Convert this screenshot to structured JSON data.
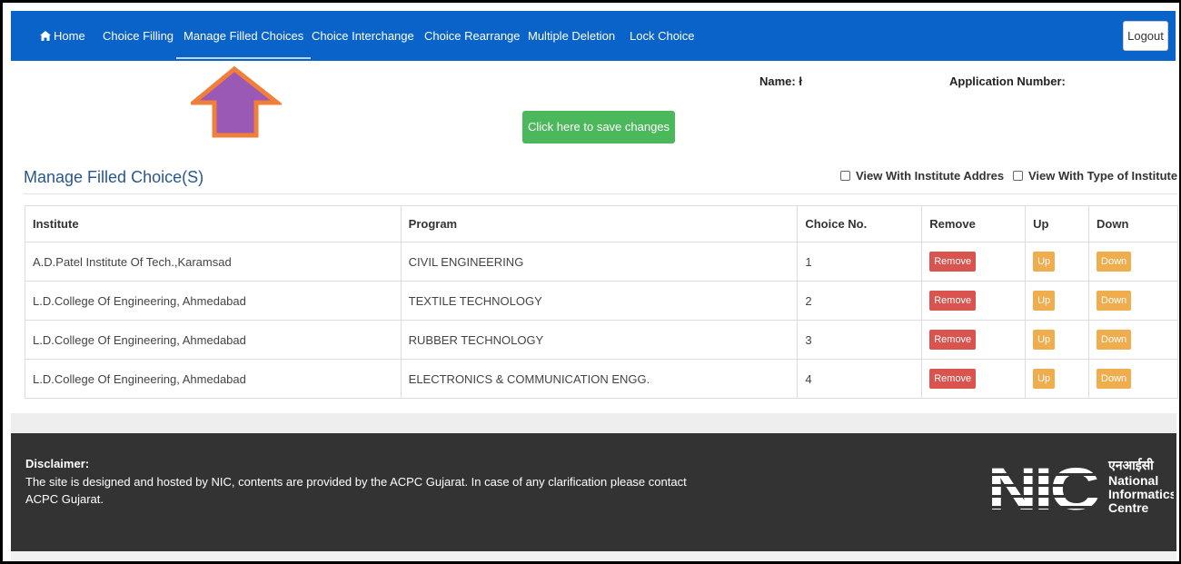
{
  "nav": {
    "items": [
      {
        "label": "Home",
        "icon": "home-icon"
      },
      {
        "label": "Choice Filling"
      },
      {
        "label": "Manage Filled Choices",
        "active": true
      },
      {
        "label": "Choice Interchange"
      },
      {
        "label": "Choice Rearrange"
      },
      {
        "label": "Multiple Deletion"
      },
      {
        "label": "Lock Choice"
      }
    ],
    "logout_label": "Logout"
  },
  "applicant": {
    "name_label": "Name: ł",
    "application_number_label": "Application Number:"
  },
  "save_button_label": "Click here to save changes",
  "section": {
    "title": "Manage Filled Choice(S)",
    "view_with_address_label": "View With Institute Addres",
    "view_with_type_label": "View With Type of Institutе"
  },
  "table": {
    "headers": [
      "Institute",
      "Program",
      "Choice No.",
      "Remove",
      "Up",
      "Down"
    ],
    "rows": [
      {
        "institute": "A.D.Patel Institute Of Tech.,Karamsad",
        "program": "CIVIL ENGINEERING",
        "choice_no": "1",
        "remove": "Remove",
        "up": "Up",
        "down": "Down"
      },
      {
        "institute": "L.D.College Of Engineering, Ahmedabad",
        "program": "TEXTILE TECHNOLOGY",
        "choice_no": "2",
        "remove": "Remove",
        "up": "Up",
        "down": "Down"
      },
      {
        "institute": "L.D.College Of Engineering, Ahmedabad",
        "program": "RUBBER TECHNOLOGY",
        "choice_no": "3",
        "remove": "Remove",
        "up": "Up",
        "down": "Down"
      },
      {
        "institute": "L.D.College Of Engineering, Ahmedabad",
        "program": "ELECTRONICS & COMMUNICATION ENGG.",
        "choice_no": "4",
        "remove": "Remove",
        "up": "Up",
        "down": "Down"
      }
    ]
  },
  "footer": {
    "disclaimer_title": "Disclaimer:",
    "disclaimer_text": "The site is designed and hosted by NIC, contents are provided by the ACPC Gujarat. In case of any clarification please contact ACPC Gujarat.",
    "logo": {
      "letters": "NIC",
      "hindi": "एनआईसी",
      "line1": "National",
      "line2": "Informatics",
      "line3": "Centre"
    }
  },
  "colors": {
    "nav_bg": "#0a63c8",
    "save_button": "#4cb85c",
    "remove_button": "#d9534f",
    "up_down_button": "#f0ad4e",
    "footer_bg": "#333333",
    "annotation_arrow": "#9b59b6",
    "annotation_arrow_border": "#f07f3a"
  }
}
